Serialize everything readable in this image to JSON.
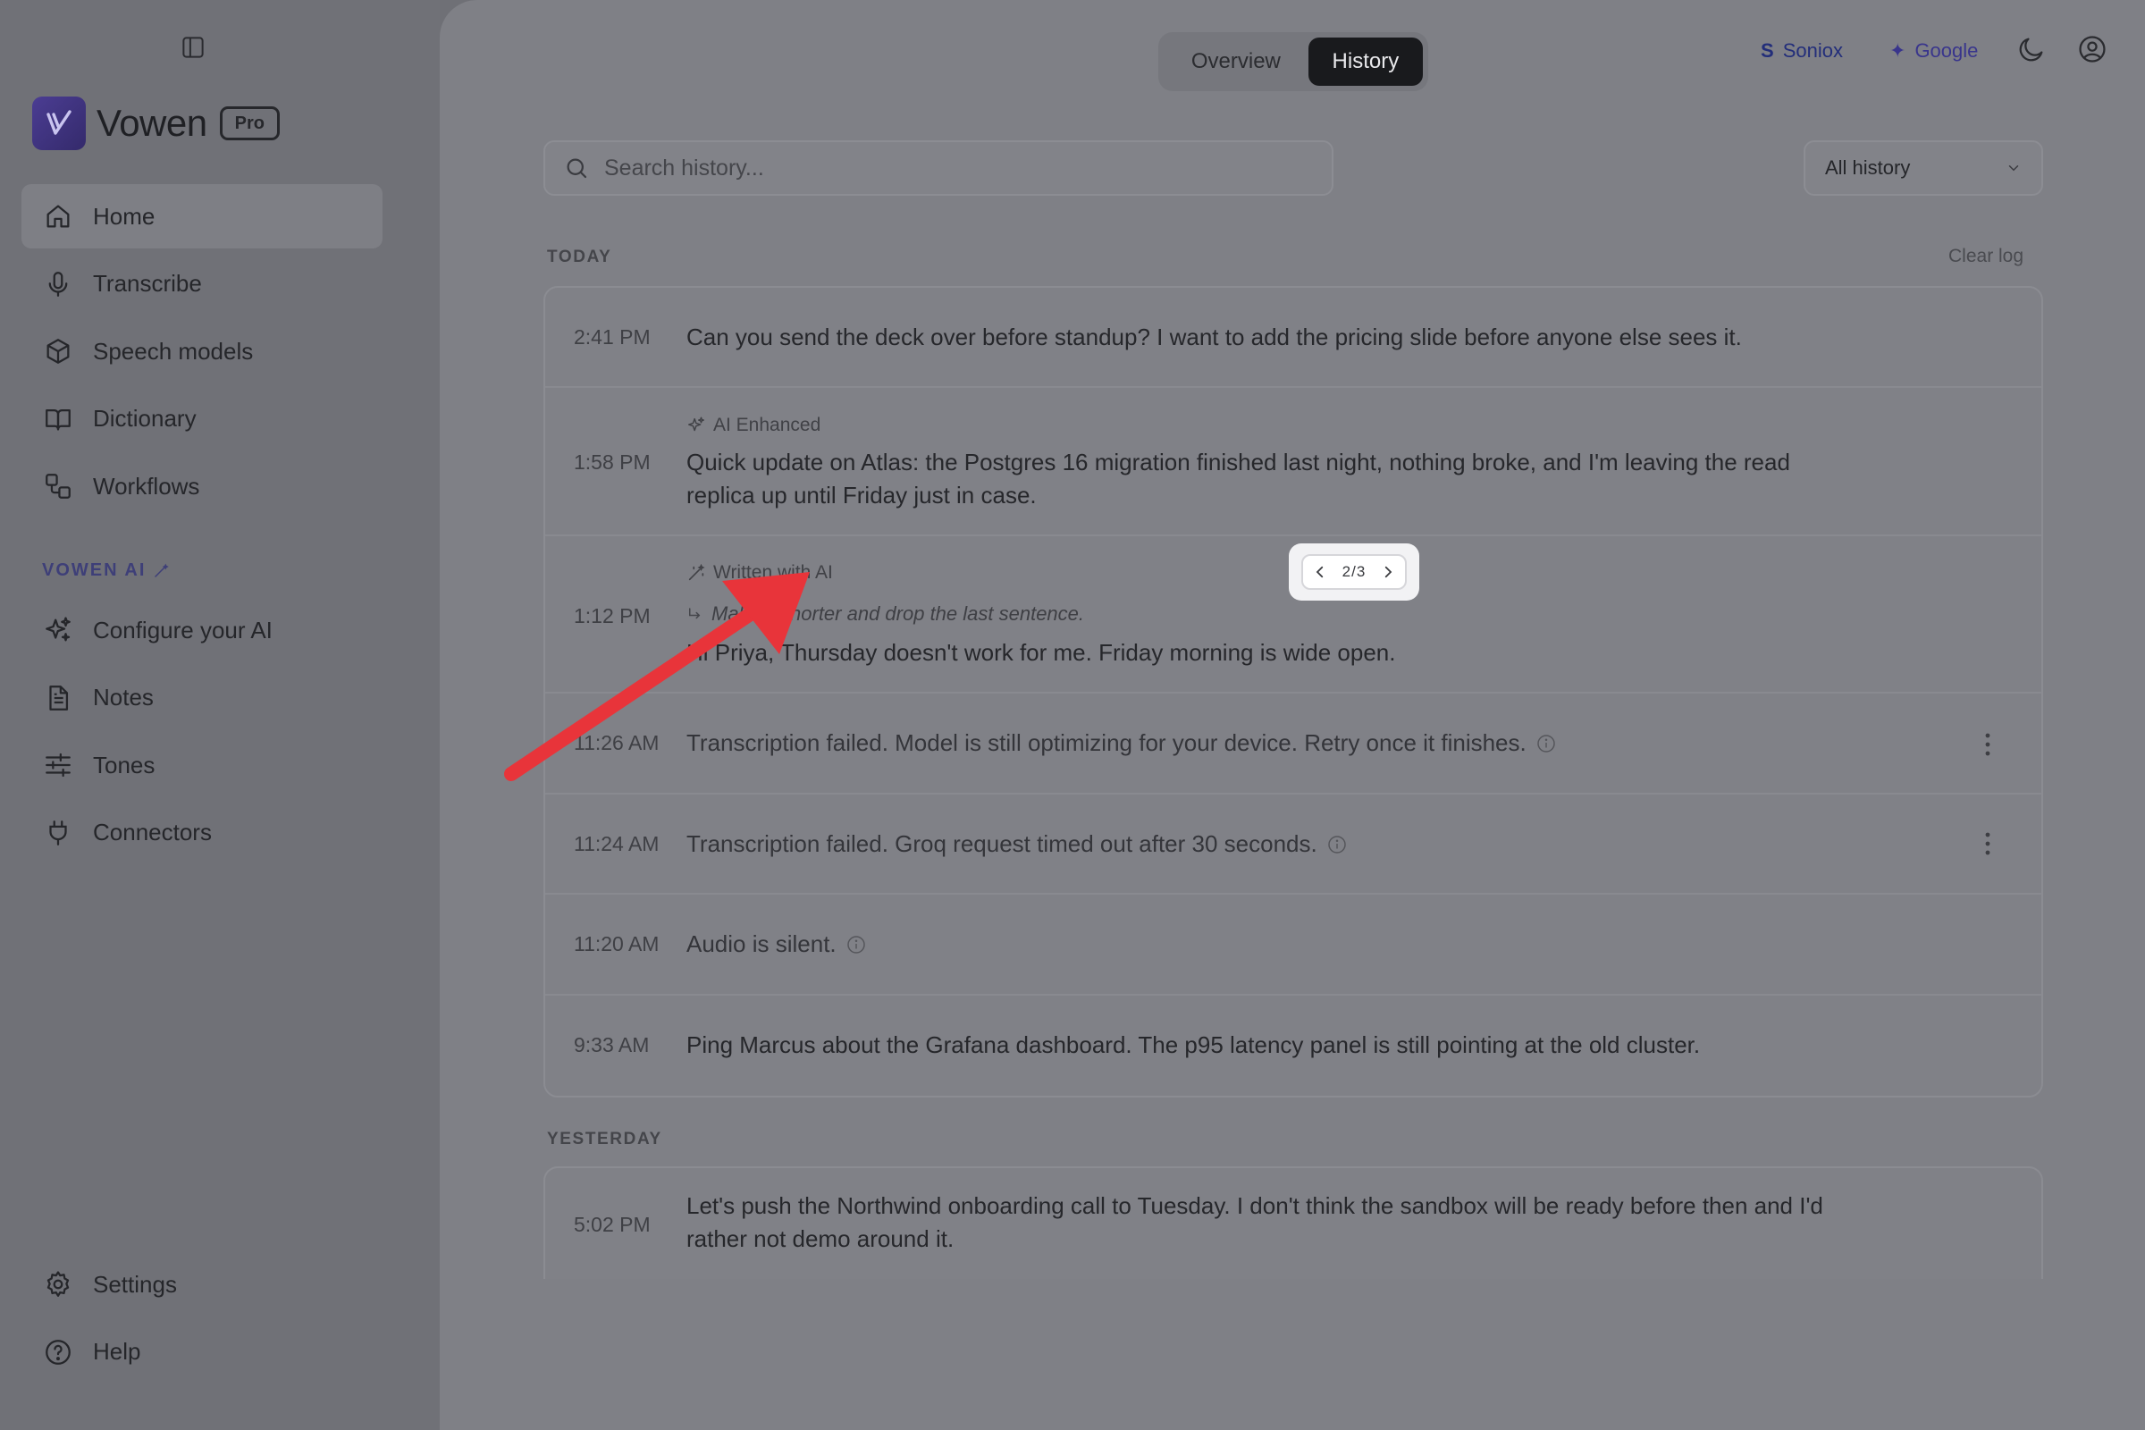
{
  "app": {
    "name": "Vowen",
    "plan_badge": "Pro",
    "brand_color": "#3d2f80"
  },
  "sidebar": {
    "nav_items": [
      {
        "label": "Home",
        "icon": "home-icon",
        "active": true
      },
      {
        "label": "Transcribe",
        "icon": "microphone-icon"
      },
      {
        "label": "Speech models",
        "icon": "cube-icon"
      },
      {
        "label": "Dictionary",
        "icon": "book-icon"
      },
      {
        "label": "Workflows",
        "icon": "workflow-icon"
      }
    ],
    "ai_section_label": "VOWEN AI",
    "ai_items": [
      {
        "label": "Configure your AI",
        "icon": "sparkles-icon"
      },
      {
        "label": "Notes",
        "icon": "document-icon"
      },
      {
        "label": "Tones",
        "icon": "sliders-icon"
      },
      {
        "label": "Connectors",
        "icon": "plug-icon"
      }
    ],
    "bottom_items": [
      {
        "label": "Settings",
        "icon": "gear-icon"
      },
      {
        "label": "Help",
        "icon": "help-circle-icon"
      }
    ]
  },
  "header": {
    "tabs": [
      {
        "label": "Overview",
        "active": false
      },
      {
        "label": "History",
        "active": true
      }
    ],
    "providers": [
      {
        "label": "Soniox",
        "icon": "S"
      },
      {
        "label": "Google",
        "icon": "✦"
      }
    ]
  },
  "history": {
    "search_placeholder": "Search history...",
    "filter_value": "All history",
    "clear_label": "Clear log",
    "groups": [
      {
        "label": "TODAY",
        "entries": [
          {
            "time": "2:41 PM",
            "text": "Can you send the deck over before standup? I want to add the pricing slide before anyone else sees it."
          },
          {
            "time": "1:58 PM",
            "tag": "AI Enhanced",
            "text": "Quick update on Atlas: the Postgres 16 migration finished last night, nothing broke, and I'm leaving the read replica up until Friday just in case."
          },
          {
            "time": "1:12 PM",
            "tag": "Written with AI",
            "instruction": "Make it shorter and drop the last sentence.",
            "text": "Hi Priya, Thursday doesn't work for me. Friday morning is wide open.",
            "pager": "2/3"
          },
          {
            "time": "11:26 AM",
            "text": "Transcription failed. Model is still optimizing for your device. Retry once it finishes.",
            "status": "error"
          },
          {
            "time": "11:24 AM",
            "text": "Transcription failed. Groq request timed out after 30 seconds.",
            "status": "error"
          },
          {
            "time": "11:20 AM",
            "text": "Audio is silent.",
            "status": "silent"
          },
          {
            "time": "9:33 AM",
            "text": "Ping Marcus about the Grafana dashboard. The p95 latency panel is still pointing at the old cluster."
          }
        ]
      },
      {
        "label": "YESTERDAY",
        "entries": [
          {
            "time": "5:02 PM",
            "text": "Let's push the Northwind onboarding call to Tuesday. I don't think the sandbox will be ready before then and I'd rather not demo around it."
          }
        ]
      }
    ]
  },
  "annotation": {
    "arrow_color": "#e8343a"
  }
}
